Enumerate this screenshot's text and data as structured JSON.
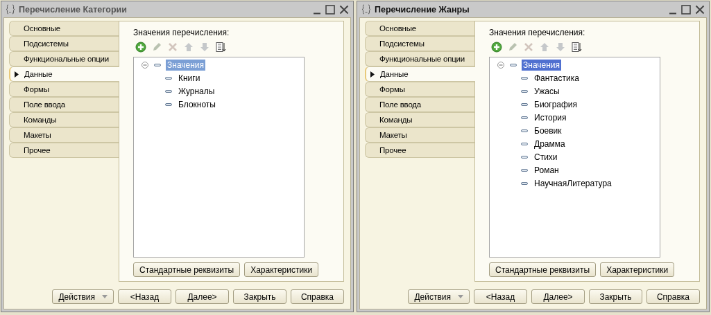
{
  "windows": [
    {
      "title": "Перечисление Категории",
      "active": false,
      "tabs": [
        {
          "label": "Основные",
          "selected": false
        },
        {
          "label": "Подсистемы",
          "selected": false
        },
        {
          "label": "Функциональные опции",
          "selected": false
        },
        {
          "label": "Данные",
          "selected": true
        },
        {
          "label": "Формы",
          "selected": false
        },
        {
          "label": "Поле ввода",
          "selected": false
        },
        {
          "label": "Команды",
          "selected": false
        },
        {
          "label": "Макеты",
          "selected": false
        },
        {
          "label": "Прочее",
          "selected": false
        }
      ],
      "list_label": "Значения перечисления:",
      "toolbar": [
        {
          "kind": "add",
          "disabled": false
        },
        {
          "kind": "edit",
          "disabled": true
        },
        {
          "kind": "delete",
          "disabled": true
        },
        {
          "kind": "up",
          "disabled": true
        },
        {
          "kind": "down",
          "disabled": true
        },
        {
          "kind": "sort",
          "disabled": false
        }
      ],
      "tree": {
        "label": "Значения",
        "expanded": true,
        "selected": true,
        "children": [
          {
            "label": "Книги",
            "selected": false
          },
          {
            "label": "Журналы",
            "selected": false
          },
          {
            "label": "Блокноты",
            "selected": false
          }
        ]
      },
      "panel_buttons": [
        "Стандартные реквизиты",
        "Характеристики"
      ],
      "actions_button": "Действия",
      "buttons": [
        "<Назад",
        "Далее>",
        "Закрыть",
        "Справка"
      ]
    },
    {
      "title": "Перечисление Жанры",
      "active": true,
      "tabs": [
        {
          "label": "Основные",
          "selected": false
        },
        {
          "label": "Подсистемы",
          "selected": false
        },
        {
          "label": "Функциональные опции",
          "selected": false
        },
        {
          "label": "Данные",
          "selected": true
        },
        {
          "label": "Формы",
          "selected": false
        },
        {
          "label": "Поле ввода",
          "selected": false
        },
        {
          "label": "Команды",
          "selected": false
        },
        {
          "label": "Макеты",
          "selected": false
        },
        {
          "label": "Прочее",
          "selected": false
        }
      ],
      "list_label": "Значения перечисления:",
      "toolbar": [
        {
          "kind": "add",
          "disabled": false
        },
        {
          "kind": "edit",
          "disabled": true
        },
        {
          "kind": "delete",
          "disabled": true
        },
        {
          "kind": "up",
          "disabled": true
        },
        {
          "kind": "down",
          "disabled": true
        },
        {
          "kind": "sort",
          "disabled": false
        }
      ],
      "tree": {
        "label": "Значения",
        "expanded": true,
        "selected": true,
        "children": [
          {
            "label": "Фантастика",
            "selected": false
          },
          {
            "label": "Ужасы",
            "selected": false
          },
          {
            "label": "Биография",
            "selected": false
          },
          {
            "label": "История",
            "selected": false
          },
          {
            "label": "Боевик",
            "selected": false
          },
          {
            "label": "Драмма",
            "selected": false
          },
          {
            "label": "Стихи",
            "selected": false
          },
          {
            "label": "Роман",
            "selected": false
          },
          {
            "label": "НаучнаяЛитература",
            "selected": false
          }
        ]
      },
      "panel_buttons": [
        "Стандартные реквизиты",
        "Характеристики"
      ],
      "actions_button": "Действия",
      "buttons": [
        "<Назад",
        "Далее>",
        "Закрыть",
        "Справка"
      ]
    }
  ]
}
